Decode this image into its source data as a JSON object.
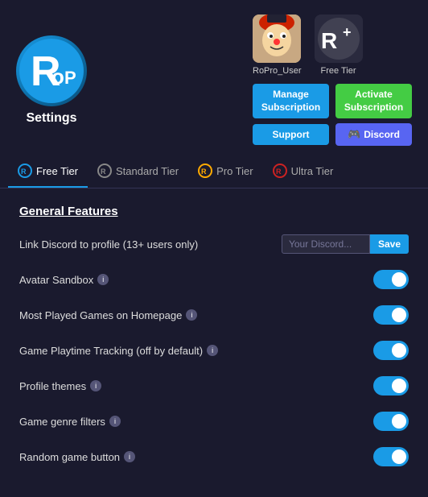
{
  "header": {
    "logo_text_r": "R",
    "logo_text_pro": "oPro",
    "settings_label": "Settings"
  },
  "user_section": {
    "user1": {
      "name": "RoPro_User",
      "tier": ""
    },
    "user2": {
      "name": "",
      "tier": "Free Tier"
    }
  },
  "buttons": {
    "manage_subscription": "Manage\nSubscription",
    "activate_subscription": "Activate\nSubscription",
    "support": "Support",
    "discord": "Discord",
    "save": "Save"
  },
  "tabs": [
    {
      "id": "free",
      "label": "Free Tier",
      "active": true
    },
    {
      "id": "standard",
      "label": "Standard Tier",
      "active": false
    },
    {
      "id": "pro",
      "label": "Pro Tier",
      "active": false
    },
    {
      "id": "ultra",
      "label": "Ultra Tier",
      "active": false
    }
  ],
  "section": {
    "title": "General Features"
  },
  "features": [
    {
      "label": "Link Discord to profile (13+ users only)",
      "has_info": false,
      "control": "discord_input",
      "placeholder": "Your Discord...",
      "enabled": true
    },
    {
      "label": "Avatar Sandbox",
      "has_info": true,
      "control": "toggle",
      "enabled": true
    },
    {
      "label": "Most Played Games on Homepage",
      "has_info": true,
      "control": "toggle",
      "enabled": true
    },
    {
      "label": "Game Playtime Tracking (off by default)",
      "has_info": true,
      "control": "toggle",
      "enabled": true
    },
    {
      "label": "Profile themes",
      "has_info": true,
      "control": "toggle",
      "enabled": true
    },
    {
      "label": "Game genre filters",
      "has_info": true,
      "control": "toggle",
      "enabled": true
    },
    {
      "label": "Random game button",
      "has_info": true,
      "control": "toggle",
      "enabled": true
    }
  ],
  "colors": {
    "blue": "#1a9be6",
    "green": "#44cc44",
    "discord_purple": "#5865f2",
    "bg_dark": "#1a1a2e",
    "toggle_on": "#1a9be6"
  }
}
